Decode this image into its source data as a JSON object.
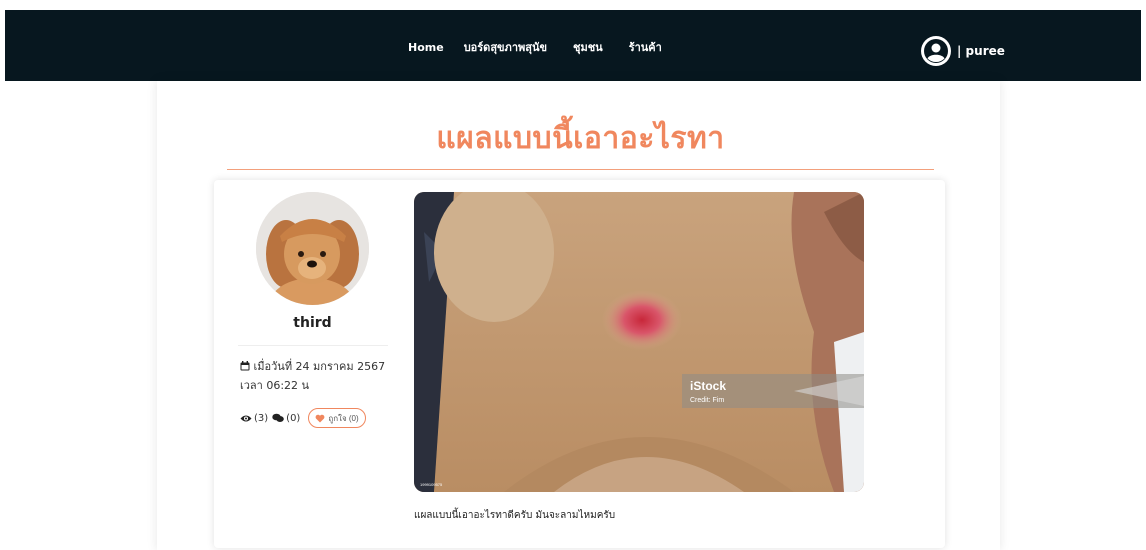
{
  "nav": {
    "links": [
      {
        "label": "Home"
      },
      {
        "label": "บอร์ดสุขภาพสุนัข"
      },
      {
        "label": "ชุมชน"
      },
      {
        "label": "ร้านค้า"
      }
    ],
    "user": {
      "text": "| puree"
    }
  },
  "post": {
    "title": "แผลแบบนี้เอาอะไรทา",
    "author": "third",
    "date_line": "เมื่อวันที่ 24 มกราคม 2567",
    "time_line": "เวลา 06:22 น",
    "views": "(3)",
    "comments": "(0)",
    "likes_label": "ถูกใจ (0)",
    "body": "แผลแบบนี้เอาอะไรทาดีครับ มันจะลามไหมครับ",
    "image_watermark_brand": "iStock",
    "image_watermark_credit": "Credit: Fim",
    "image_id_tag": "1999109575"
  },
  "colors": {
    "navbar": "#07171f",
    "accent": "#f0875e"
  },
  "icons": [
    "user-avatar-icon",
    "calendar-icon",
    "eye-icon",
    "comments-icon",
    "heart-icon"
  ]
}
